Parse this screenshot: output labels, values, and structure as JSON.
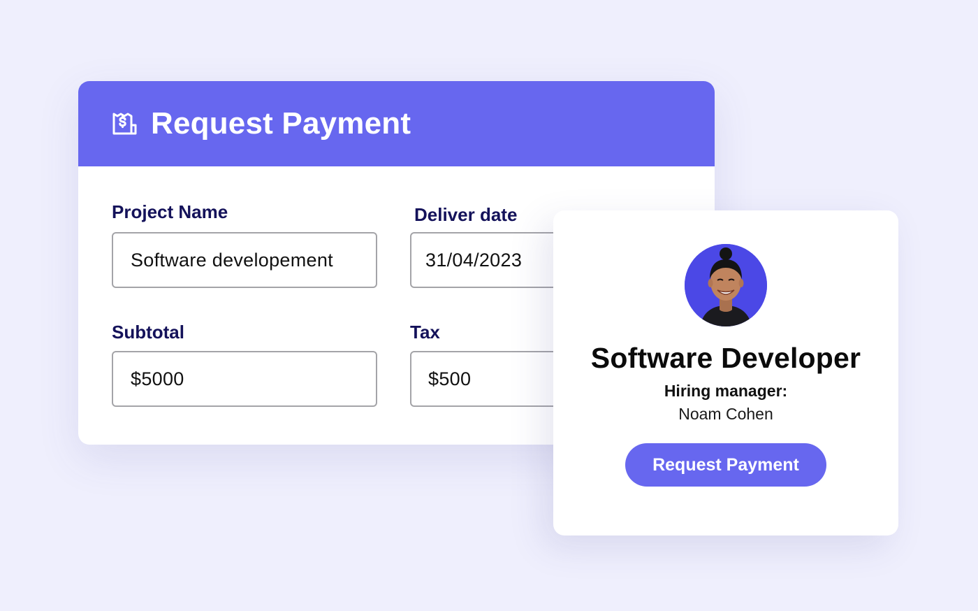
{
  "form": {
    "title": "Request Payment",
    "header_icon": "receipt-dollar-icon",
    "accent_color": "#6767ef",
    "label_color": "#14125a",
    "fields": {
      "project_name": {
        "label": "Project Name",
        "value": "Software developement"
      },
      "deliver_date": {
        "label": "Deliver date",
        "value": "31/04/2023"
      },
      "subtotal": {
        "label": "Subtotal",
        "value": "$5000"
      },
      "tax": {
        "label": "Tax",
        "value": "$500"
      }
    }
  },
  "profile": {
    "avatar_icon": "person-avatar",
    "role_title": "Software Developer",
    "manager_label": "Hiring manager:",
    "manager_name": "Noam Cohen",
    "button_label": "Request Payment"
  }
}
